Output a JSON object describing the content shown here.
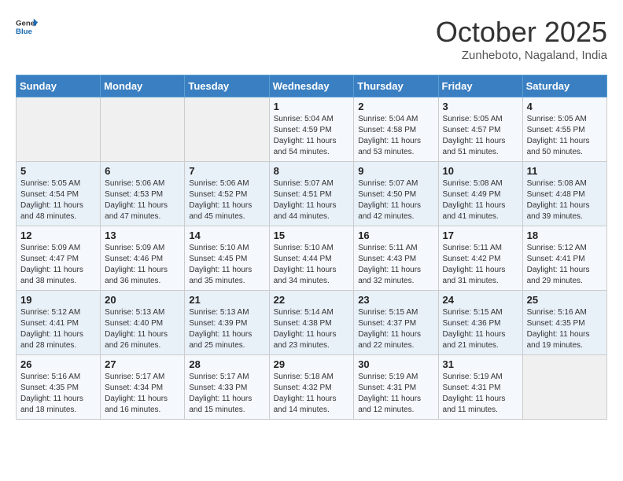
{
  "header": {
    "logo_line1": "General",
    "logo_line2": "Blue",
    "month": "October 2025",
    "location": "Zunheboto, Nagaland, India"
  },
  "days_of_week": [
    "Sunday",
    "Monday",
    "Tuesday",
    "Wednesday",
    "Thursday",
    "Friday",
    "Saturday"
  ],
  "weeks": [
    [
      {
        "day": "",
        "content": ""
      },
      {
        "day": "",
        "content": ""
      },
      {
        "day": "",
        "content": ""
      },
      {
        "day": "1",
        "content": "Sunrise: 5:04 AM\nSunset: 4:59 PM\nDaylight: 11 hours and 54 minutes."
      },
      {
        "day": "2",
        "content": "Sunrise: 5:04 AM\nSunset: 4:58 PM\nDaylight: 11 hours and 53 minutes."
      },
      {
        "day": "3",
        "content": "Sunrise: 5:05 AM\nSunset: 4:57 PM\nDaylight: 11 hours and 51 minutes."
      },
      {
        "day": "4",
        "content": "Sunrise: 5:05 AM\nSunset: 4:55 PM\nDaylight: 11 hours and 50 minutes."
      }
    ],
    [
      {
        "day": "5",
        "content": "Sunrise: 5:05 AM\nSunset: 4:54 PM\nDaylight: 11 hours and 48 minutes."
      },
      {
        "day": "6",
        "content": "Sunrise: 5:06 AM\nSunset: 4:53 PM\nDaylight: 11 hours and 47 minutes."
      },
      {
        "day": "7",
        "content": "Sunrise: 5:06 AM\nSunset: 4:52 PM\nDaylight: 11 hours and 45 minutes."
      },
      {
        "day": "8",
        "content": "Sunrise: 5:07 AM\nSunset: 4:51 PM\nDaylight: 11 hours and 44 minutes."
      },
      {
        "day": "9",
        "content": "Sunrise: 5:07 AM\nSunset: 4:50 PM\nDaylight: 11 hours and 42 minutes."
      },
      {
        "day": "10",
        "content": "Sunrise: 5:08 AM\nSunset: 4:49 PM\nDaylight: 11 hours and 41 minutes."
      },
      {
        "day": "11",
        "content": "Sunrise: 5:08 AM\nSunset: 4:48 PM\nDaylight: 11 hours and 39 minutes."
      }
    ],
    [
      {
        "day": "12",
        "content": "Sunrise: 5:09 AM\nSunset: 4:47 PM\nDaylight: 11 hours and 38 minutes."
      },
      {
        "day": "13",
        "content": "Sunrise: 5:09 AM\nSunset: 4:46 PM\nDaylight: 11 hours and 36 minutes."
      },
      {
        "day": "14",
        "content": "Sunrise: 5:10 AM\nSunset: 4:45 PM\nDaylight: 11 hours and 35 minutes."
      },
      {
        "day": "15",
        "content": "Sunrise: 5:10 AM\nSunset: 4:44 PM\nDaylight: 11 hours and 34 minutes."
      },
      {
        "day": "16",
        "content": "Sunrise: 5:11 AM\nSunset: 4:43 PM\nDaylight: 11 hours and 32 minutes."
      },
      {
        "day": "17",
        "content": "Sunrise: 5:11 AM\nSunset: 4:42 PM\nDaylight: 11 hours and 31 minutes."
      },
      {
        "day": "18",
        "content": "Sunrise: 5:12 AM\nSunset: 4:41 PM\nDaylight: 11 hours and 29 minutes."
      }
    ],
    [
      {
        "day": "19",
        "content": "Sunrise: 5:12 AM\nSunset: 4:41 PM\nDaylight: 11 hours and 28 minutes."
      },
      {
        "day": "20",
        "content": "Sunrise: 5:13 AM\nSunset: 4:40 PM\nDaylight: 11 hours and 26 minutes."
      },
      {
        "day": "21",
        "content": "Sunrise: 5:13 AM\nSunset: 4:39 PM\nDaylight: 11 hours and 25 minutes."
      },
      {
        "day": "22",
        "content": "Sunrise: 5:14 AM\nSunset: 4:38 PM\nDaylight: 11 hours and 23 minutes."
      },
      {
        "day": "23",
        "content": "Sunrise: 5:15 AM\nSunset: 4:37 PM\nDaylight: 11 hours and 22 minutes."
      },
      {
        "day": "24",
        "content": "Sunrise: 5:15 AM\nSunset: 4:36 PM\nDaylight: 11 hours and 21 minutes."
      },
      {
        "day": "25",
        "content": "Sunrise: 5:16 AM\nSunset: 4:35 PM\nDaylight: 11 hours and 19 minutes."
      }
    ],
    [
      {
        "day": "26",
        "content": "Sunrise: 5:16 AM\nSunset: 4:35 PM\nDaylight: 11 hours and 18 minutes."
      },
      {
        "day": "27",
        "content": "Sunrise: 5:17 AM\nSunset: 4:34 PM\nDaylight: 11 hours and 16 minutes."
      },
      {
        "day": "28",
        "content": "Sunrise: 5:17 AM\nSunset: 4:33 PM\nDaylight: 11 hours and 15 minutes."
      },
      {
        "day": "29",
        "content": "Sunrise: 5:18 AM\nSunset: 4:32 PM\nDaylight: 11 hours and 14 minutes."
      },
      {
        "day": "30",
        "content": "Sunrise: 5:19 AM\nSunset: 4:31 PM\nDaylight: 11 hours and 12 minutes."
      },
      {
        "day": "31",
        "content": "Sunrise: 5:19 AM\nSunset: 4:31 PM\nDaylight: 11 hours and 11 minutes."
      },
      {
        "day": "",
        "content": ""
      }
    ]
  ]
}
